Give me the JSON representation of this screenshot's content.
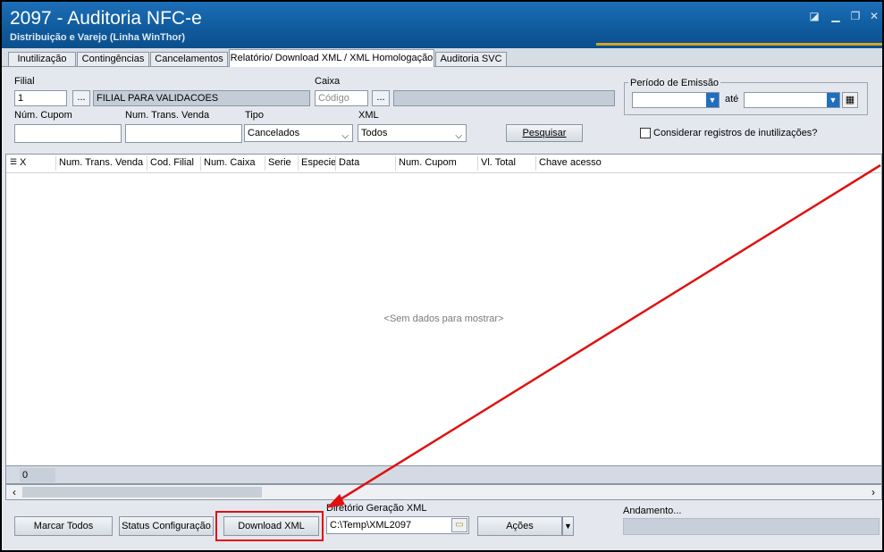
{
  "window": {
    "title": "2097 - Auditoria NFC-e",
    "subtitle": "Distribuição e Varejo (Linha WinThor)",
    "controls": [
      "restore-icon",
      "minimize-icon",
      "maximize-icon",
      "close-icon"
    ]
  },
  "tabs": [
    {
      "label": "Inutilização",
      "active": false
    },
    {
      "label": "Contingências",
      "active": false
    },
    {
      "label": "Cancelamentos",
      "active": false
    },
    {
      "label": "Relatório/ Download XML / XML Homologação",
      "active": true
    },
    {
      "label": "Auditoria SVC",
      "active": false
    }
  ],
  "filters": {
    "filial_label": "Filial",
    "filial_value": "1",
    "filial_name": "FILIAL PARA VALIDACOES",
    "caixa_label": "Caixa",
    "caixa_placeholder": "Código",
    "ellipsis": "...",
    "cupom_label": "Núm. Cupom",
    "trans_label": "Num. Trans. Venda",
    "tipo_label": "Tipo",
    "tipo_value": "Cancelados",
    "xml_label": "XML",
    "xml_value": "Todos",
    "search_button": "Pesquisar",
    "periodo_label": "Período de Emissão",
    "ate_label": "até",
    "checkbox_label": "Considerar registros de inutilizações?",
    "checkbox_checked": false
  },
  "grid": {
    "columns": [
      "X",
      "Num. Trans. Venda",
      "Cod. Filial",
      "Num. Caixa",
      "Serie",
      "Especie",
      "Data",
      "Num. Cupom",
      "Vl. Total",
      "Chave acesso"
    ],
    "empty_text": "<Sem dados para mostrar>",
    "footer_count": "0"
  },
  "bottom": {
    "mark_all": "Marcar Todos",
    "status_config": "Status Configuração",
    "download_xml": "Download XML",
    "dir_label": "Diretório Geração XML",
    "dir_value": "C:\\Temp\\XML2097",
    "actions": "Ações",
    "progress_label": "Andamento..."
  },
  "annotation": {
    "color": "#e01010"
  }
}
